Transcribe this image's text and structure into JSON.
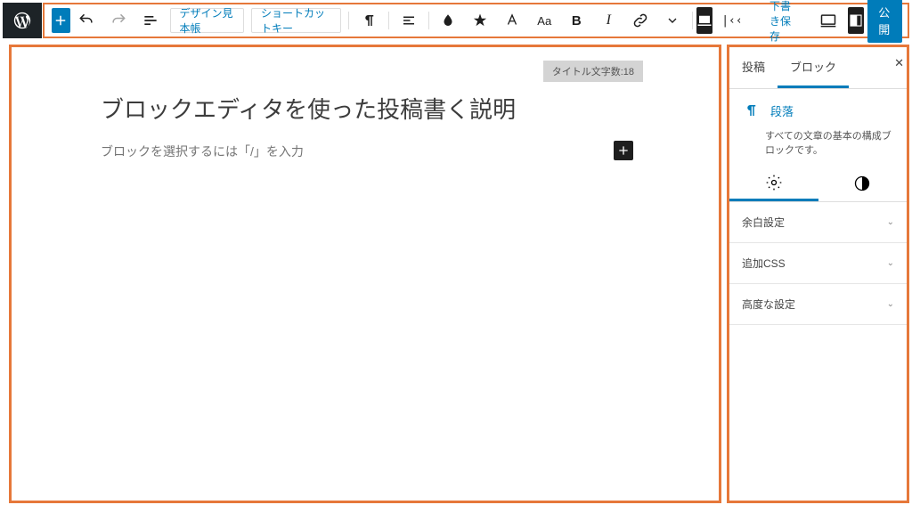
{
  "toolbar": {
    "design_sample": "デザイン見本帳",
    "shortcut_keys": "ショートカットキー",
    "save_draft": "下書き保存"
  },
  "publish_label": "公開",
  "editor": {
    "title_count": "タイトル文字数:18",
    "post_title": "ブロックエディタを使った投稿書く説明",
    "block_placeholder": "ブロックを選択するには「/」を入力"
  },
  "sidebar": {
    "tabs": {
      "post": "投稿",
      "block": "ブロック"
    },
    "block_name": "段落",
    "block_desc": "すべての文章の基本の構成ブロックです。",
    "panels": {
      "margin": "余白設定",
      "css": "追加CSS",
      "advanced": "高度な設定"
    }
  }
}
